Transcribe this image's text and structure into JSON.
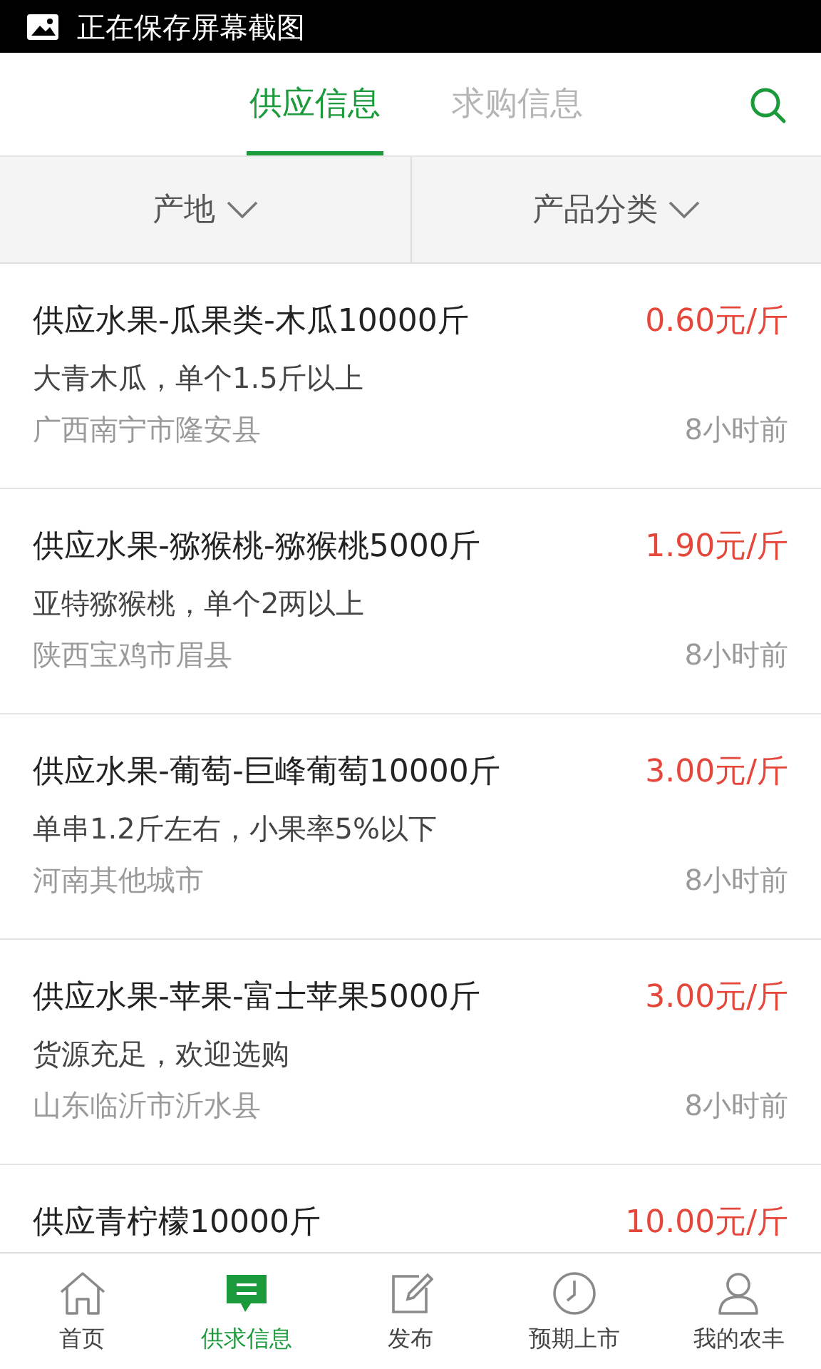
{
  "status_bar": {
    "text": "正在保存屏幕截图"
  },
  "tabs": [
    {
      "label": "供应信息",
      "selected": true
    },
    {
      "label": "求购信息",
      "selected": false
    }
  ],
  "filters": [
    {
      "label": "产地"
    },
    {
      "label": "产品分类"
    }
  ],
  "listings": [
    {
      "title": "供应水果-瓜果类-木瓜10000斤",
      "price": "0.60元/斤",
      "description": "大青木瓜，单个1.5斤以上",
      "location": "广西南宁市隆安县",
      "time": "8小时前"
    },
    {
      "title": "供应水果-猕猴桃-猕猴桃5000斤",
      "price": "1.90元/斤",
      "description": "亚特猕猴桃，单个2两以上",
      "location": "陕西宝鸡市眉县",
      "time": "8小时前"
    },
    {
      "title": "供应水果-葡萄-巨峰葡萄10000斤",
      "price": "3.00元/斤",
      "description": "单串1.2斤左右，小果率5%以下",
      "location": "河南其他城市",
      "time": "8小时前"
    },
    {
      "title": "供应水果-苹果-富士苹果5000斤",
      "price": "3.00元/斤",
      "description": "货源充足，欢迎选购",
      "location": "山东临沂市沂水县",
      "time": "8小时前"
    },
    {
      "title": "供应青柠檬10000斤",
      "price": "10.00元/斤"
    }
  ],
  "bottom_nav": [
    {
      "kind": "home",
      "label": "首页",
      "selected": false
    },
    {
      "kind": "message",
      "label": "供求信息",
      "selected": true
    },
    {
      "kind": "edit",
      "label": "发布",
      "selected": false
    },
    {
      "kind": "clock",
      "label": "预期上市",
      "selected": false
    },
    {
      "kind": "user",
      "label": "我的农丰",
      "selected": false
    }
  ]
}
